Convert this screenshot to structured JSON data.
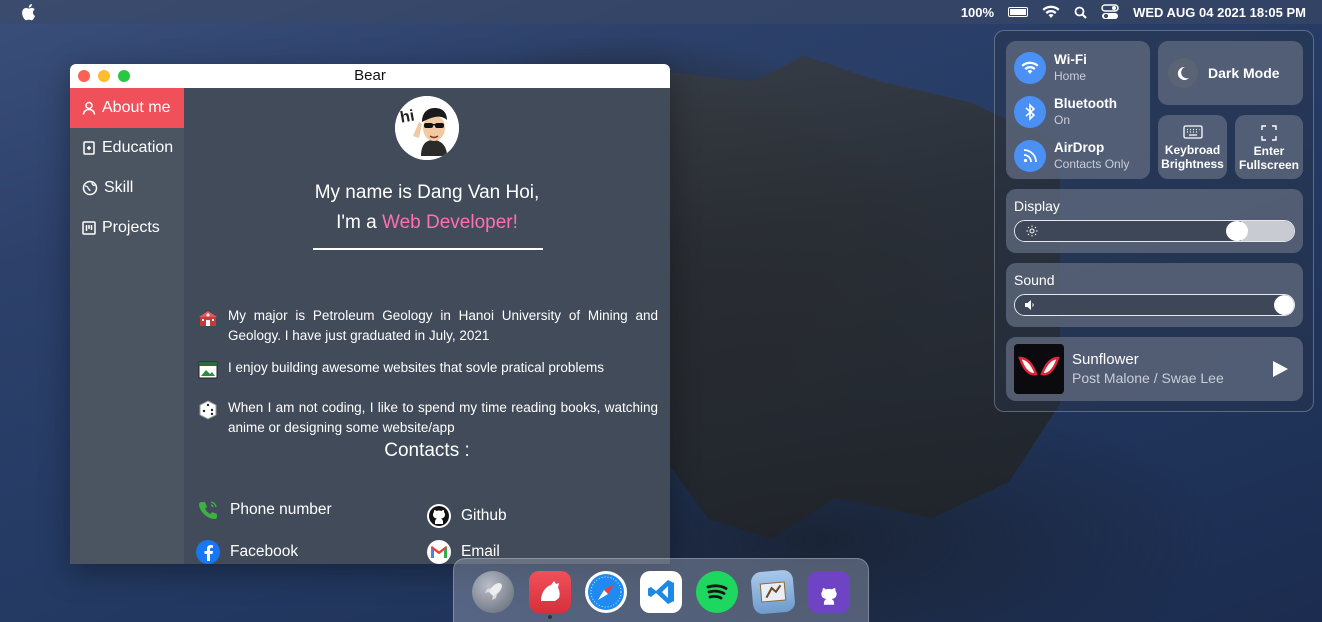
{
  "menubar": {
    "battery_percent": "100%",
    "datetime": "WED AUG 04 2021 18:05 PM",
    "icons": [
      "apple-icon",
      "battery-icon",
      "wifi-icon",
      "search-icon",
      "control-center-icon"
    ]
  },
  "window": {
    "title": "Bear",
    "traffic_lights": {
      "close": "#fe5f57",
      "minimize": "#febc2e",
      "zoom": "#28c840"
    }
  },
  "sidebar": {
    "items": [
      {
        "label": "About me",
        "icon": "user-icon",
        "active": true
      },
      {
        "label": "Education",
        "icon": "book-icon",
        "active": false
      },
      {
        "label": "Skill",
        "icon": "globe-icon",
        "active": false
      },
      {
        "label": "Projects",
        "icon": "board-icon",
        "active": false
      }
    ]
  },
  "about": {
    "intro_line1": "My name is Dang Van Hoi,",
    "intro_prefix": "I'm a ",
    "intro_highlight": "Web Developer!",
    "bio": [
      {
        "icon": "school-icon",
        "text": "My major is Petroleum Geology in Hanoi University of Mining and Geology. I have just graduated in July, 2021"
      },
      {
        "icon": "website-icon",
        "text": "I enjoy building awesome websites that sovle pratical problems"
      },
      {
        "icon": "dice-icon",
        "text": "When I am not coding, I like to spend my time reading books, watching anime or designing some website/app"
      }
    ],
    "contacts_title": "Contacts :",
    "contacts": {
      "phone": "Phone number",
      "github": "Github",
      "facebook": "Facebook",
      "email": "Email"
    }
  },
  "control_center": {
    "wifi": {
      "title": "Wi-Fi",
      "status": "Home"
    },
    "bluetooth": {
      "title": "Bluetooth",
      "status": "On"
    },
    "airdrop": {
      "title": "AirDrop",
      "status": "Contacts Only"
    },
    "dark_mode": "Dark Mode",
    "keyboard_brightness_1": "Keybroad",
    "keyboard_brightness_2": "Brightness",
    "fullscreen_1": "Enter",
    "fullscreen_2": "Fullscreen",
    "display": {
      "label": "Display",
      "level": 0.83
    },
    "sound": {
      "label": "Sound",
      "level": 1.0
    },
    "now_playing": {
      "title": "Sunflower",
      "artist": "Post Malone / Swae Lee"
    }
  },
  "dock": {
    "apps": [
      "launchpad-icon",
      "bear-icon",
      "safari-icon",
      "vscode-icon",
      "spotify-icon",
      "mail-icon",
      "github-icon"
    ]
  },
  "colors": {
    "accent_red": "#f0505a",
    "highlight_pink": "#ff6fb1",
    "toggle_blue": "#4a90f5"
  }
}
